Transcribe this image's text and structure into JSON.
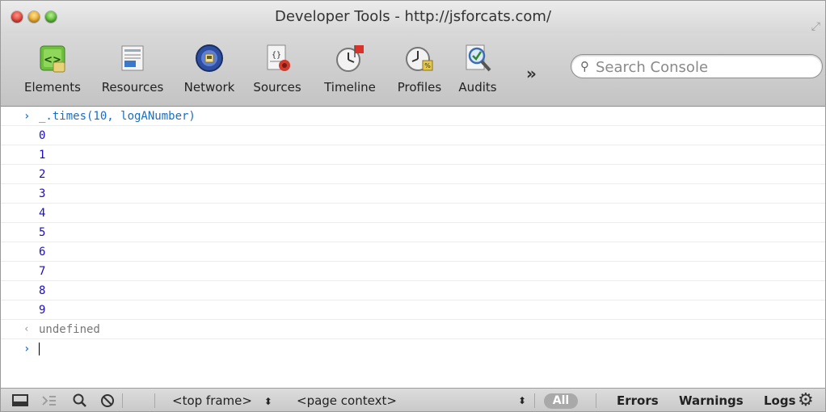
{
  "window": {
    "title": "Developer Tools - http://jsforcats.com/"
  },
  "toolbar": {
    "tools": [
      {
        "label": "Elements",
        "icon": "elements-icon"
      },
      {
        "label": "Resources",
        "icon": "resources-icon"
      },
      {
        "label": "Network",
        "icon": "network-icon"
      },
      {
        "label": "Sources",
        "icon": "sources-icon"
      },
      {
        "label": "Timeline",
        "icon": "timeline-icon"
      },
      {
        "label": "Profiles",
        "icon": "profiles-icon"
      },
      {
        "label": "Audits",
        "icon": "audits-icon"
      }
    ],
    "overflow": "»",
    "search_placeholder": "Search Console"
  },
  "console": {
    "command": "_.times(10, logANumber)",
    "outputs": [
      "0",
      "1",
      "2",
      "3",
      "4",
      "5",
      "6",
      "7",
      "8",
      "9"
    ],
    "result": "undefined",
    "prompt_symbol": "›",
    "result_symbol": "‹"
  },
  "statusbar": {
    "frame_select": "<top frame>",
    "context_select": "<page context>",
    "filter_all": "All",
    "filter_errors": "Errors",
    "filter_warnings": "Warnings",
    "filter_logs": "Logs"
  },
  "colors": {
    "command": "#1a6ec4",
    "output_number": "#1c0dbc",
    "result": "#777777",
    "prompt_arrow": "#2d7bd1"
  }
}
